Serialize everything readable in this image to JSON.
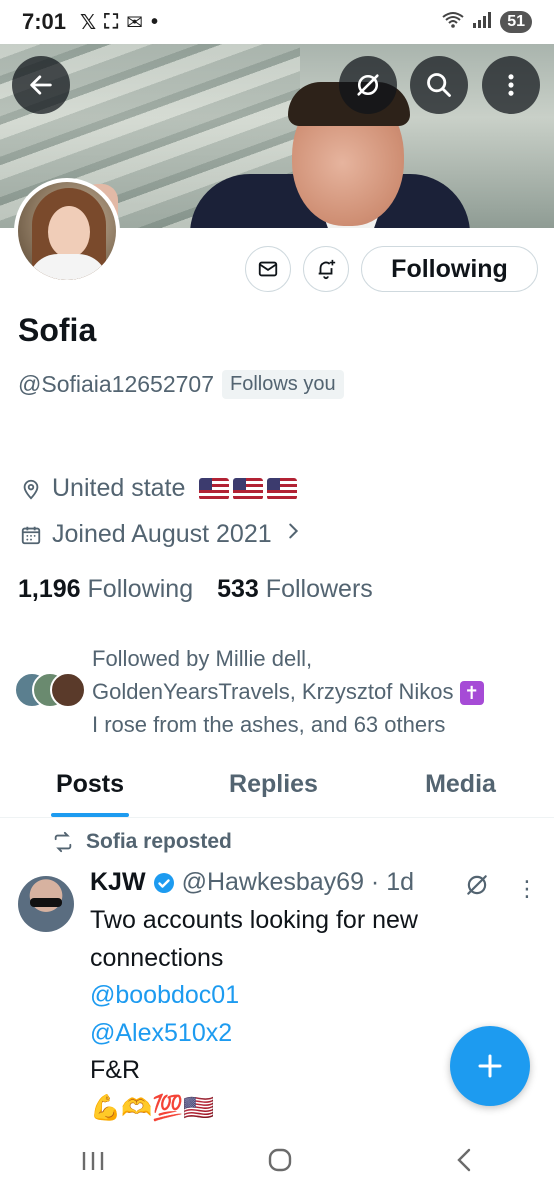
{
  "status_bar": {
    "time": "7:01",
    "left_icons": [
      "x-logo-icon",
      "screenshot-icon",
      "mail-icon",
      "dot-icon"
    ],
    "right_icons": [
      "wifi-icon",
      "signal-icon"
    ],
    "battery": "51"
  },
  "header": {
    "back_icon": "arrow-left-icon",
    "grok_icon": "grok-icon",
    "search_icon": "search-icon",
    "more_icon": "more-vertical-icon"
  },
  "profile": {
    "name": "Sofia",
    "handle": "@Sofiaia12652707",
    "follows_you": "Follows you",
    "location": "United state",
    "location_flags": 3,
    "joined": "Joined August 2021",
    "following_count": "1,196",
    "following_label": "Following",
    "followers_count": "533",
    "followers_label": "Followers",
    "followed_by_line1": "Followed by Millie dell,",
    "followed_by_line2": "GoldenYearsTravels, Krzysztof Nikos",
    "followed_by_line3": "I rose from the ashes, and 63 others",
    "following_button": "Following"
  },
  "tabs": [
    {
      "label": "Posts",
      "active": true
    },
    {
      "label": "Replies",
      "active": false
    },
    {
      "label": "Media",
      "active": false
    }
  ],
  "post": {
    "repost_label": "Sofia reposted",
    "author": "KJW",
    "handle_time": "@Hawkesbay69 · 1d",
    "line1": "Two accounts looking for new",
    "line2": "connections",
    "mention1": "@boobdoc01",
    "mention2": "@Alex510x2",
    "line3": "F&R",
    "emojis": "💪🫶💯🇺🇸"
  },
  "colors": {
    "accent": "#1d9bf0",
    "text_primary": "#0f1419",
    "text_secondary": "#536471"
  }
}
